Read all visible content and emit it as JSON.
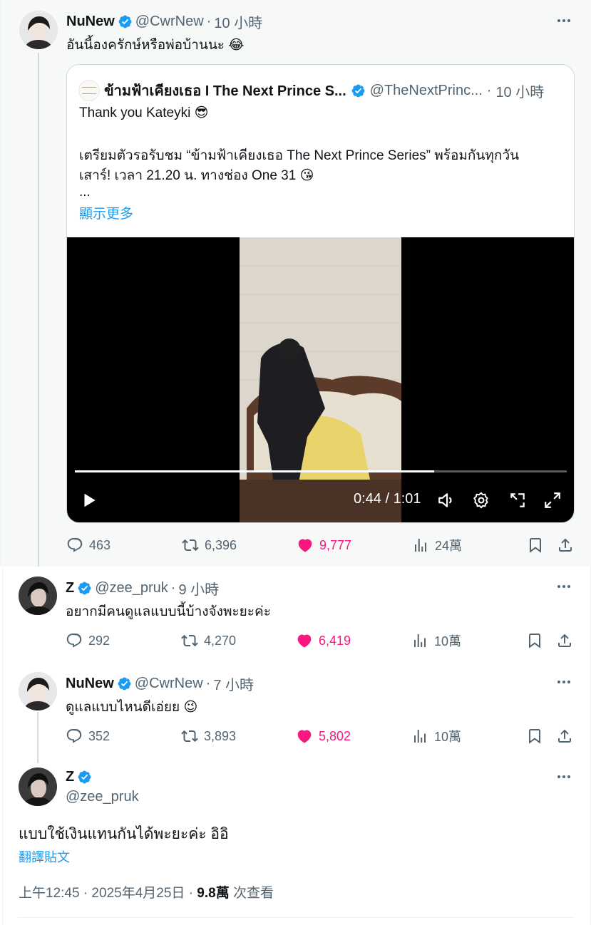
{
  "tweets": [
    {
      "name": "NuNew",
      "handle": "@CwrNew",
      "separator": "·",
      "time": "10 小時",
      "text": "อันนี้องครักษ์หรือพ่อบ้านนะ",
      "emoji": "😂",
      "quote": {
        "name": "ข้ามฟ้าเคียงเธอ I The Next Prince S...",
        "handle": "@TheNextPrinc...",
        "separator": "·",
        "time": "10 小時",
        "line1": "Thank you Kateyki",
        "line1_emoji": "😎",
        "line2": "เตรียมตัวรอรับชม “ข้ามฟ้าเคียงเธอ The Next Prince Series” พร้อมกันทุกวัน",
        "line3": "เสาร์! เวลา 21.20 น. ทางช่อง One 31",
        "line3_emoji": "😘",
        "ellipsis": "...",
        "show_more": "顯示更多",
        "video": {
          "timecode": "0:44 / 1:01",
          "progress": 0.73
        }
      },
      "actions": {
        "replies": "463",
        "reposts": "6,396",
        "likes": "9,777",
        "views": "24萬"
      }
    },
    {
      "name": "Z",
      "handle": "@zee_pruk",
      "separator": "·",
      "time": "9 小時",
      "text": "อยากมีคนดูแลแบบนี้บ้างจังพะยะค่ะ",
      "actions": {
        "replies": "292",
        "reposts": "4,270",
        "likes": "6,419",
        "views": "10萬"
      }
    },
    {
      "name": "NuNew",
      "handle": "@CwrNew",
      "separator": "·",
      "time": "7 小時",
      "text": "ดูแลแบบไหนดีเอ่ยย",
      "emoji": "😉",
      "actions": {
        "replies": "352",
        "reposts": "3,893",
        "likes": "5,802",
        "views": "10萬"
      }
    }
  ],
  "main_tweet": {
    "name": "Z",
    "handle": "@zee_pruk",
    "text": "แบบใช้เงินแทนกันได้พะยะค่ะ อิอิ",
    "translate": "翻譯貼文",
    "timestamp": "上午12:45 · 2025年4月25日 ·",
    "views_count": "9.8萬",
    "views_label": "次查看"
  },
  "colors": {
    "accent": "#1d9bf0",
    "like": "#f91880",
    "muted": "#536471",
    "text": "#0f1419"
  }
}
